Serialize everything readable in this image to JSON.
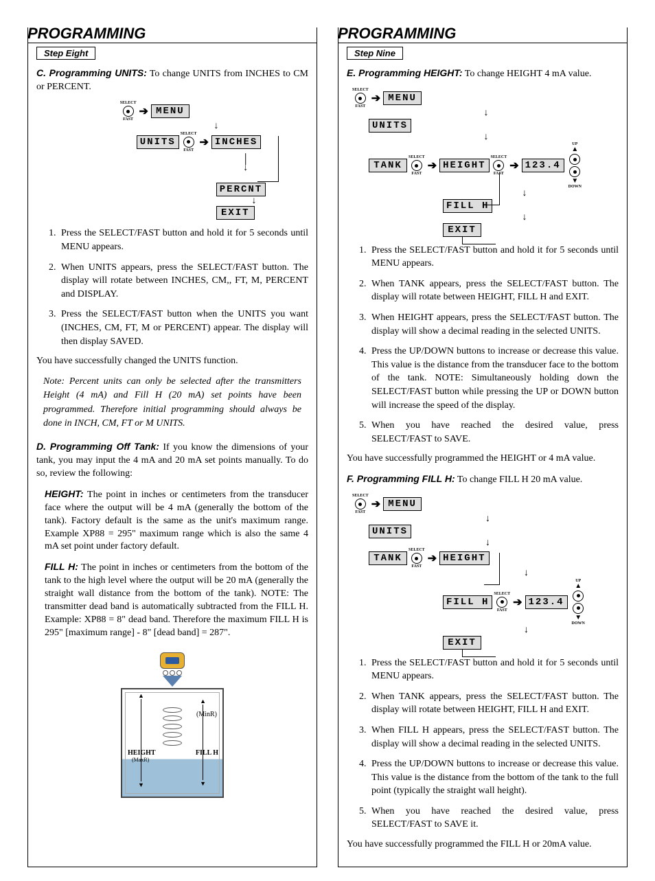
{
  "left": {
    "heading": "PROGRAMMING",
    "step_label": "Step Eight",
    "sectionC": {
      "title": "C. Programming UNITS:",
      "intro": "To change UNITS from INCHES to CM or PERCENT.",
      "steps": [
        "Press the SELECT/FAST button and hold it for 5 seconds until MENU appears.",
        "When UNITS appears, press the SELECT/FAST button. The display will rotate between INCHES, CM,, FT, M, PERCENT and DISPLAY.",
        "Press the SELECT/FAST button when the UNITS you want (INCHES, CM, FT, M or PERCENT) appear.  The display will then display SAVED."
      ],
      "success": "You have successfully changed the UNITS function.",
      "note": "Note:  Percent units can only be selected after the transmitters Height (4 mA) and Fill H (20 mA) set points have been programmed. Therefore initial programming should always be done in INCH, CM, FT or M UNITS."
    },
    "sectionD": {
      "title": "D. Programming Off Tank:",
      "intro": "If you know the dimensions of your tank, you may input the 4 mA and 20 mA set points manually. To do so, review the following:",
      "height_label": "HEIGHT:",
      "height_text": "The point in inches or centimeters from the transducer face where the output will be 4 mA (generally the bottom of the tank). Factory default is the same as the unit's maximum range. Example XP88 = 295\" maximum range which is also the same 4 mA set point under factory default.",
      "fillh_label": "FILL H:",
      "fillh_text": "The point in inches or centimeters from the bottom of the tank to the high level where the output will be 20 mA (generally the straight wall distance from the bottom of the tank). NOTE: The transmitter dead band is automatically subtracted from the FILL H. Example: XP88 = 8\" dead band. Therefore the maximum FILL H is 295\" [maximum range] - 8\" [dead band] = 287\"."
    },
    "flowC": {
      "btn_top": "SELECT",
      "btn_bot": "FAST",
      "menu": "MENU",
      "units": "UNITS",
      "inches": "INCHES",
      "percnt": "PERCNT",
      "exit": "EXIT"
    },
    "tank": {
      "minr": "(MinR)",
      "height": "HEIGHT",
      "maxr": "(MaxR)",
      "fillh": "FILL H"
    }
  },
  "right": {
    "heading": "PROGRAMMING",
    "step_label": "Step Nine",
    "sectionE": {
      "title": "E. Programming HEIGHT:",
      "intro": "To change HEIGHT 4 mA value.",
      "steps": [
        "Press the SELECT/FAST button and hold it for 5 seconds until MENU appears.",
        "When TANK appears, press the SELECT/FAST button. The display will rotate between HEIGHT, FILL H and EXIT.",
        "When HEIGHT appears, press the SELECT/FAST button. The display will show a decimal reading in the selected UNITS.",
        "Press the UP/DOWN buttons to increase or decrease this value. This value is the distance from the transducer face to the bottom of the tank. NOTE: Simultaneously holding down the SELECT/FAST button while pressing the UP or DOWN button will increase the speed of the display.",
        "When you have reached the desired value, press SELECT/FAST to SAVE."
      ],
      "success": "You have successfully programmed the HEIGHT or 4 mA value."
    },
    "sectionF": {
      "title": "F. Programming FILL H:",
      "intro": "To change FILL H 20 mA value.",
      "steps": [
        "Press the SELECT/FAST button and hold it for 5 seconds until MENU appears.",
        "When TANK appears, press the SELECT/FAST button. The display will rotate between HEIGHT, FILL H and EXIT.",
        "When FILL H appears, press the SELECT/FAST button. The display will show a decimal reading in the selected UNITS.",
        "Press the UP/DOWN buttons to increase or decrease this value. This value is the distance from the bottom of the tank to the full point (typically the straight wall height).",
        "When you have reached the desired value, press SELECT/FAST to SAVE it."
      ],
      "success": "You have successfully programmed the FILL H or 20mA value."
    },
    "flow": {
      "btn_top": "SELECT",
      "btn_bot": "FAST",
      "up": "UP",
      "down": "DOWN",
      "menu": "MENU",
      "units": "UNITS",
      "tank": "TANK",
      "height": "HEIGHT",
      "fillh": "FILL H",
      "exit": "EXIT",
      "value": "123.4"
    }
  }
}
